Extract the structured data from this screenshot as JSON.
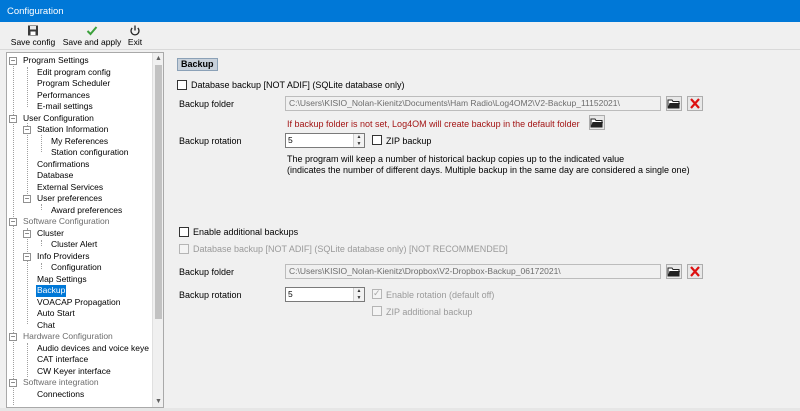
{
  "window": {
    "title": "Configuration"
  },
  "toolbar": {
    "save_config": "Save config",
    "save_and_apply": "Save and apply",
    "exit": "Exit"
  },
  "tree": {
    "program_settings": "Program Settings",
    "edit_program_config": "Edit program config",
    "program_scheduler": "Program Scheduler",
    "performances": "Performances",
    "email_settings": "E-mail settings",
    "user_configuration": "User Configuration",
    "station_information": "Station Information",
    "my_references": "My References",
    "station_configuration": "Station configuration",
    "confirmations": "Confirmations",
    "database": "Database",
    "external_services": "External Services",
    "user_preferences": "User preferences",
    "award_preferences": "Award preferences",
    "software_configuration": "Software Configuration",
    "cluster": "Cluster",
    "cluster_alert": "Cluster Alert",
    "info_providers": "Info Providers",
    "configuration": "Configuration",
    "map_settings": "Map Settings",
    "backup": "Backup",
    "voacap_propagation": "VOACAP Propagation",
    "auto_start": "Auto Start",
    "chat": "Chat",
    "hardware_configuration": "Hardware Configuration",
    "audio_devices": "Audio devices and voice keye",
    "cat_interface": "CAT interface",
    "cw_keyer_interface": "CW Keyer interface",
    "software_integration": "Software integration",
    "connections": "Connections"
  },
  "backup": {
    "section_title": "Backup",
    "db_backup_label": "Database backup [NOT ADIF] (SQLite database only)",
    "backup_folder_label": "Backup folder",
    "backup_folder_value": "C:\\Users\\KISIO_Nolan-Kienitz\\Documents\\Ham Radio\\Log4OM2\\V2-Backup_11152021\\",
    "default_folder_warning": "If backup folder is not set, Log4OM will create backup in the default folder",
    "backup_rotation_label": "Backup rotation",
    "backup_rotation_value": "5",
    "zip_backup_label": "ZIP backup",
    "rotation_note_1": "The program will keep a number of historical backup copies up to the indicated value",
    "rotation_note_2": "(indicates the number of different days. Multiple backup in the same day are considered a single one)"
  },
  "additional": {
    "enable_label": "Enable additional backups",
    "db_backup_label": "Database backup [NOT ADIF] (SQLite database only) [NOT RECOMMENDED]",
    "backup_folder_label": "Backup folder",
    "backup_folder_value": "C:\\Users\\KISIO_Nolan-Kienitz\\Dropbox\\V2-Dropbox-Backup_06172021\\",
    "backup_rotation_label": "Backup rotation",
    "backup_rotation_value": "5",
    "enable_rotation_label": "Enable rotation (default off)",
    "zip_additional_label": "ZIP additional backup"
  },
  "colors": {
    "titlebar": "#0078d7",
    "selection": "#0078d7",
    "warning_text": "#a31515",
    "section_header": "#c8d1db"
  }
}
